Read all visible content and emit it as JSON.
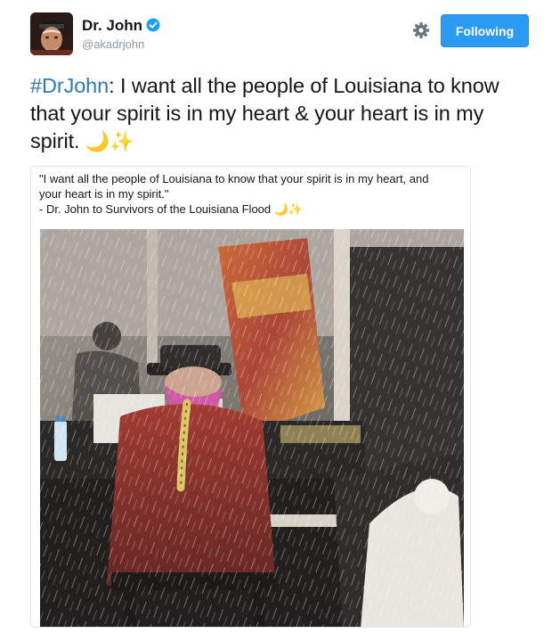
{
  "user": {
    "display_name": "Dr. John",
    "handle": "@akadrjohn",
    "follow_label": "Following",
    "icons": [
      "verified-badge-icon",
      "gear-icon"
    ],
    "accent_color": "#2b9af3"
  },
  "tweet": {
    "hashtag": "#DrJohn",
    "text": ": I want all the people of Louisiana to know that your spirit is in my heart & your heart is in my spirit. ",
    "emoji": "🌙✨"
  },
  "card": {
    "lines": [
      "\"I want all the people of Louisiana to know that your spirit is in my heart, and",
      "your heart is in my spirit.\"",
      "- Dr. John to Survivors of the Louisiana Flood 🌙✨"
    ]
  }
}
